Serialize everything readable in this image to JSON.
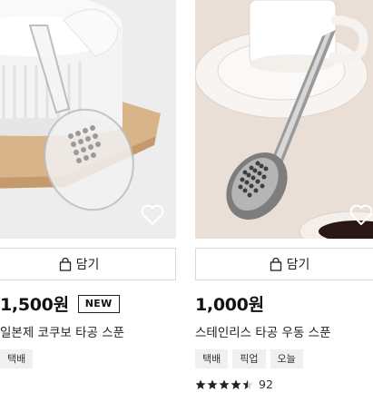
{
  "products": [
    {
      "cart_label": "담기",
      "price": "1,500원",
      "badge": "NEW",
      "title": "일본제 코쿠보 타공 스푼",
      "tags": [
        "택배"
      ]
    },
    {
      "cart_label": "담기",
      "price": "1,000원",
      "title": "스테인리스 타공 우동 스푼",
      "tags": [
        "택배",
        "픽업",
        "오늘"
      ],
      "rating": 4.5,
      "review_count": "92"
    }
  ],
  "colors": {
    "accent_text": "#111111",
    "tag_bg": "#f0f0f0",
    "border": "#d9d9d9"
  }
}
